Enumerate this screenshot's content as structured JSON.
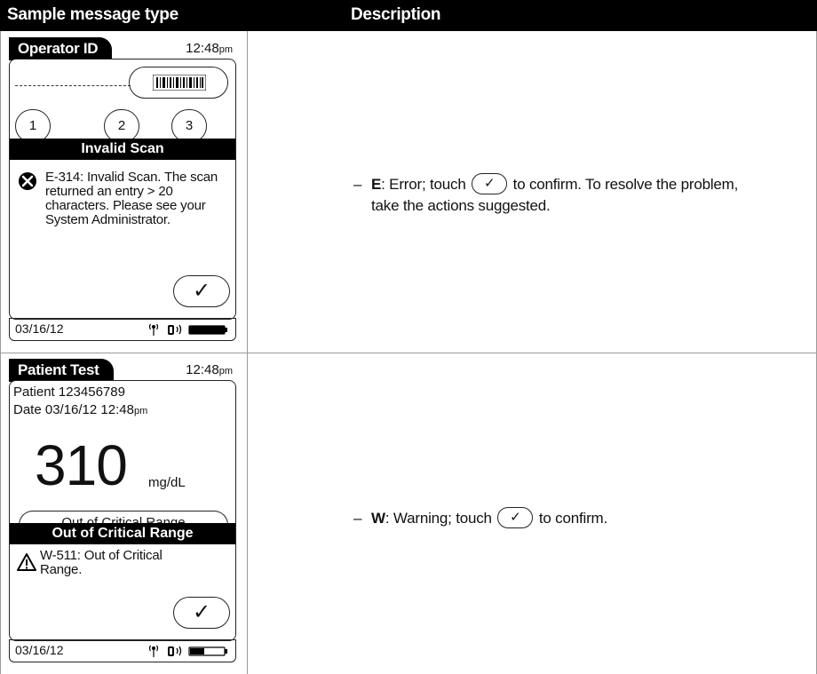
{
  "table": {
    "col1_header": "Sample message type",
    "col2_header": "Description"
  },
  "row1": {
    "screen": {
      "title": "Operator ID",
      "time": "12:48",
      "time_suffix": "pm",
      "keypad": [
        "1",
        "2",
        "3"
      ],
      "dialog_title": "Invalid Scan",
      "dialog_message": "E-314: Invalid Scan. The scan returned an entry > 20 characters. Please see your System Administrator.",
      "confirm_glyph": "✓",
      "date": "03/16/12"
    },
    "desc": {
      "code": "E",
      "text_before": ": Error; touch",
      "text_after": "to confirm. To resolve the problem,",
      "line2": "take the actions suggested."
    }
  },
  "row2": {
    "screen": {
      "title": "Patient Test",
      "time": "12:48",
      "time_suffix": "pm",
      "patient_line": "Patient 123456789",
      "date_line": "Date 03/16/12 12:48",
      "date_line_suffix": "pm",
      "result_value": "310",
      "result_unit": "mg/dL",
      "range_label": "Out of Critical Range",
      "dialog_title": "Out of Critical Range",
      "dialog_message": "W-511: Out of Critical Range.",
      "confirm_glyph": "✓",
      "date": "03/16/12"
    },
    "desc": {
      "code": "W",
      "text_before": ": Warning; touch",
      "text_after": "to confirm."
    }
  },
  "icons": {
    "error": "x-circle-icon",
    "warning": "warning-triangle-icon",
    "barcode": "barcode-icon",
    "antenna": "antenna-icon",
    "wireless": "wireless-icon",
    "battery": "battery-icon",
    "checkmark": "checkmark-icon"
  }
}
